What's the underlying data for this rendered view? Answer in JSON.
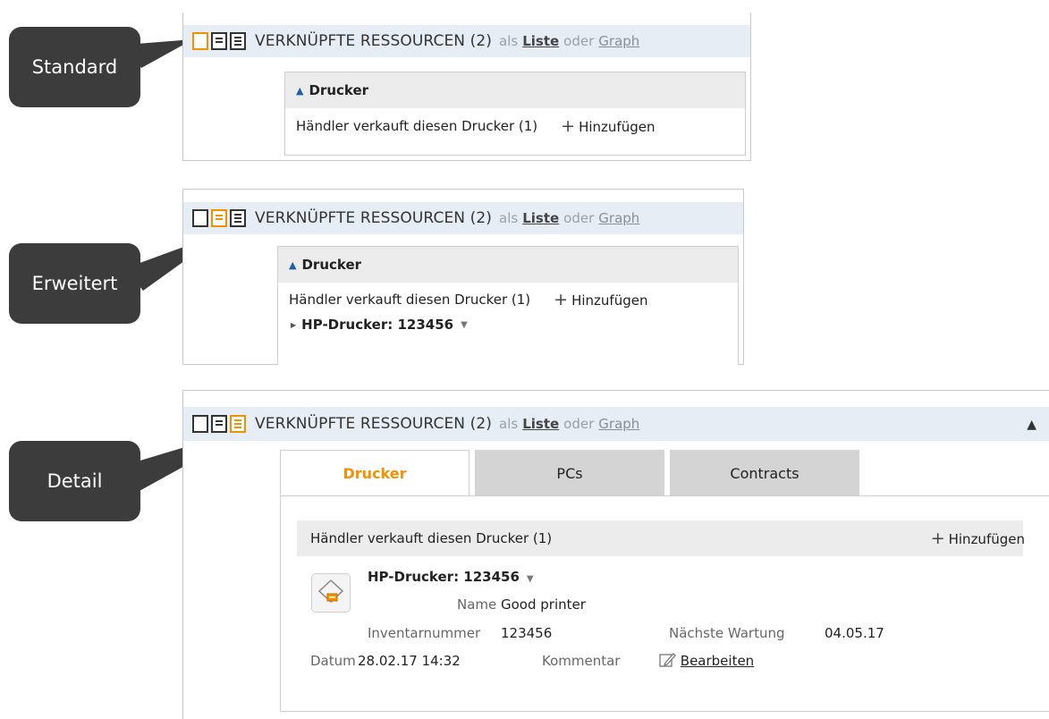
{
  "callouts": {
    "standard": "Standard",
    "erweitert": "Erweitert",
    "detail": "Detail"
  },
  "header": {
    "title": "VERKNÜPFTE RESSOURCEN (2)",
    "as_text": "als",
    "liste_link": "Liste",
    "or_text": "oder",
    "graph_link": "Graph"
  },
  "section": {
    "title": "Drucker",
    "relation": "Händler verkauft diesen Drucker (1)",
    "add_label": "Hinzufügen",
    "add_plus": "+"
  },
  "item": {
    "title": "HP-Drucker: 123456",
    "fields": {
      "name_label": "Name",
      "name_value": "Good printer",
      "inventory_label": "Inventarnummer",
      "inventory_value": "123456",
      "maintenance_label": "Nächste Wartung",
      "maintenance_value": "04.05.17",
      "date_label": "Datum",
      "date_value": "28.02.17 14:32",
      "comment_label": "Kommentar",
      "edit_link": "Bearbeiten"
    }
  },
  "tabs": [
    {
      "label": "Drucker",
      "active": true
    },
    {
      "label": "PCs",
      "active": false
    },
    {
      "label": "Contracts",
      "active": false
    }
  ],
  "view_modes": {
    "standard_selected": "standard",
    "erweitert_selected": "extended",
    "detail_selected": "detail"
  },
  "colors": {
    "accent": "#f39200",
    "header_bg": "#e6edf5",
    "callout_bg": "#3c3c3c",
    "link_blue": "#1f5fa8"
  }
}
